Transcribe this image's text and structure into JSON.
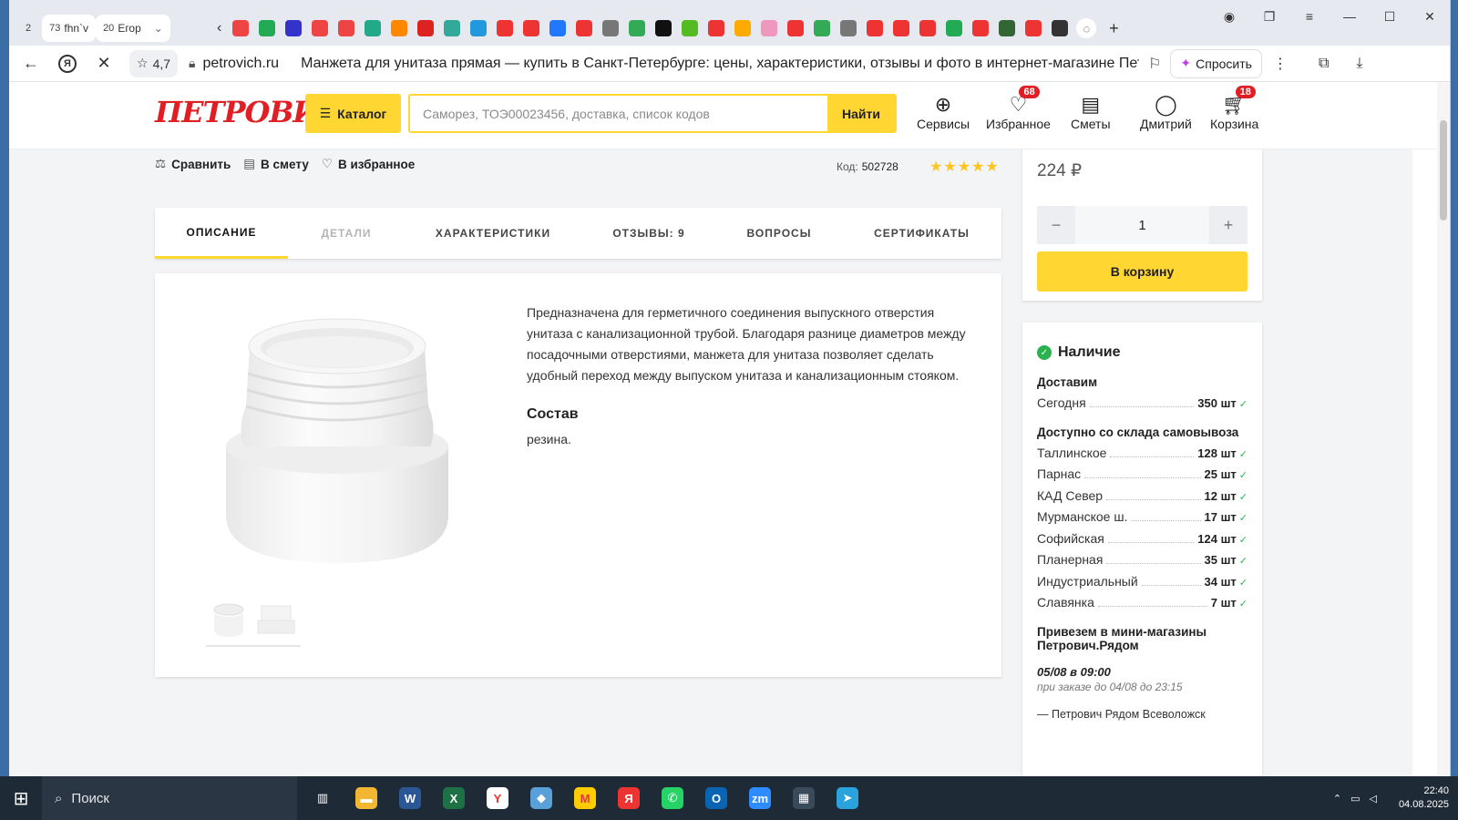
{
  "browser": {
    "tab_counters": [
      {
        "num": "2",
        "label": ""
      },
      {
        "num": "73",
        "label": "fhn`v"
      },
      {
        "num": "20",
        "label": "Егор"
      }
    ],
    "tab_icons": [
      "#e44",
      "#2a5",
      "#33c",
      "#e44",
      "#e44",
      "#2a8",
      "#f80",
      "#d22",
      "#3a9",
      "#29d",
      "#e33",
      "#e33",
      "#27f",
      "#e33",
      "#777",
      "#3a5",
      "#111",
      "#5b2",
      "#e33",
      "#fa0",
      "#e9b",
      "#e33",
      "#3a5",
      "#777",
      "#e33",
      "#e33",
      "#e33",
      "#2a5",
      "#e33",
      "#363",
      "#e33",
      "#333"
    ],
    "address": {
      "rating": "4,7",
      "domain": "petrovich.ru",
      "title": "Манжета для унитаза прямая — купить в Санкт-Петербурге: цены, характеристики, отзывы и фото в интернет-магазине Пет..."
    },
    "ask_label": "Спросить"
  },
  "site": {
    "logo": "ПЕТРОВИЧ",
    "catalog_label": "Каталог",
    "search_placeholder": "Саморез, ТОЭ00023456, доставка, список кодов",
    "search_button": "Найти",
    "header_items": [
      {
        "label": "Сервисы",
        "icon": "globe-icon",
        "badge": ""
      },
      {
        "label": "Избранное",
        "icon": "heart-icon",
        "badge": "68"
      },
      {
        "label": "Сметы",
        "icon": "document-icon",
        "badge": ""
      },
      {
        "label": "Дмитрий",
        "icon": "user-icon",
        "badge": ""
      },
      {
        "label": "Корзина",
        "icon": "cart-icon",
        "badge": "18"
      }
    ]
  },
  "product": {
    "actions": [
      "Сравнить",
      "В смету",
      "В избранное"
    ],
    "code_label": "Код:",
    "code_value": "502728",
    "rating_stars": 5,
    "tabs": [
      {
        "label": "ОПИСАНИЕ",
        "state": "active"
      },
      {
        "label": "ДЕТАЛИ",
        "state": "disabled"
      },
      {
        "label": "ХАРАКТЕРИСТИКИ",
        "state": "normal"
      },
      {
        "label": "ОТЗЫВЫ: 9",
        "state": "normal"
      },
      {
        "label": "ВОПРОСЫ",
        "state": "normal"
      },
      {
        "label": "СЕРТИФИКАТЫ",
        "state": "normal"
      }
    ],
    "description": "Предназначена для герметичного соединения выпускного отверстия унитаза с канализационной трубой. Благодаря разнице диаметров между посадочными отверстиями, манжета для унитаза позволяет сделать удобный переход между выпуском унитаза и канализационным стояком.",
    "composition_title": "Состав",
    "composition_value": "резина.",
    "price": "224 ₽",
    "quantity": "1",
    "qty_minus": "−",
    "qty_plus": "+",
    "cart_button": "В корзину"
  },
  "stock": {
    "title": "Наличие",
    "deliver_title": "Доставим",
    "deliver_rows": [
      {
        "name": "Сегодня",
        "qty": "350 шт"
      }
    ],
    "pickup_title": "Доступно со склада самовывоза",
    "pickup_rows": [
      {
        "name": "Таллинское",
        "qty": "128 шт"
      },
      {
        "name": "Парнас",
        "qty": "25 шт"
      },
      {
        "name": "КАД Север",
        "qty": "12 шт"
      },
      {
        "name": "Мурманское ш.",
        "qty": "17 шт"
      },
      {
        "name": "Софийская",
        "qty": "124 шт"
      },
      {
        "name": "Планерная",
        "qty": "35 шт"
      },
      {
        "name": "Индустриальный",
        "qty": "34 шт"
      },
      {
        "name": "Славянка",
        "qty": "7 шт"
      }
    ],
    "mini_title": "Привезем в мини-магазины Петрович.Рядом",
    "mini_date": "05/08 в 09:00",
    "mini_note": "при заказе до 04/08 до 23:15",
    "mini_shop": "— Петрович Рядом Всеволожск"
  },
  "taskbar": {
    "search_label": "Поиск",
    "apps": [
      {
        "name": "task-view",
        "color": "#1f2a37",
        "glyph": "▥"
      },
      {
        "name": "explorer",
        "color": "#f2b632",
        "glyph": "▬"
      },
      {
        "name": "word",
        "color": "#2b5797",
        "glyph": "W"
      },
      {
        "name": "excel",
        "color": "#1e7145",
        "glyph": "X"
      },
      {
        "name": "yandex-browser",
        "color": "#ffffff",
        "glyph": "Y"
      },
      {
        "name": "notes",
        "color": "#5aa0d8",
        "glyph": "◆"
      },
      {
        "name": "yandex-market",
        "color": "#ffcc00",
        "glyph": "M"
      },
      {
        "name": "yandex",
        "color": "#e33",
        "glyph": "Я"
      },
      {
        "name": "whatsapp",
        "color": "#25d366",
        "glyph": "✆"
      },
      {
        "name": "outlook",
        "color": "#0a64b4",
        "glyph": "O"
      },
      {
        "name": "zoom",
        "color": "#2d8cff",
        "glyph": "zm"
      },
      {
        "name": "calculator",
        "color": "#3a4a5a",
        "glyph": "▦"
      },
      {
        "name": "telegram",
        "color": "#2aa3dd",
        "glyph": "➤"
      }
    ],
    "time": "22:40",
    "date": "04.08.2025"
  }
}
